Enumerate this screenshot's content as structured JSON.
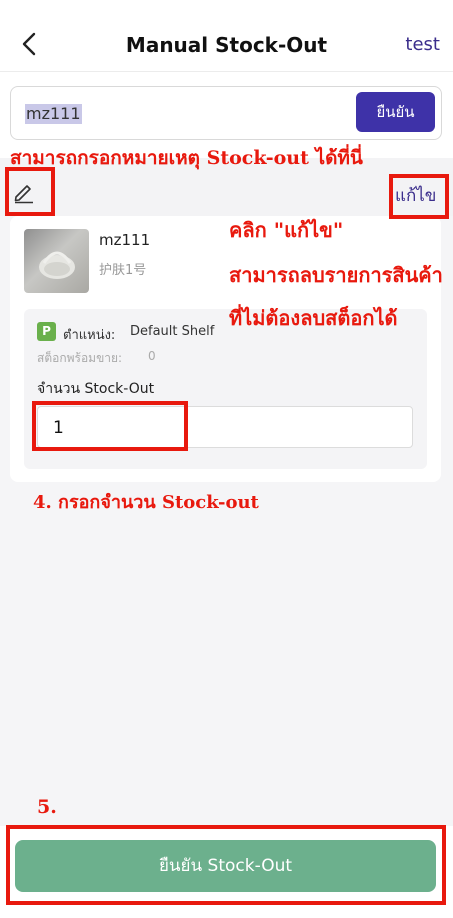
{
  "header": {
    "title": "Manual Stock-Out",
    "right_link": "test"
  },
  "search": {
    "value": "mz111",
    "confirm_label": "ยืนยัน"
  },
  "note": {
    "edit_link": "แก้ไข"
  },
  "product": {
    "name": "mz111",
    "subtitle": "护肤1号",
    "location_badge": "P",
    "location_label": "ตำแหน่ง:",
    "location_value": "Default Shelf",
    "available_label": "สต็อกพร้อมขาย:",
    "available_value": "0",
    "quantity_label": "จำนวน Stock-Out",
    "quantity_value": "1"
  },
  "footer": {
    "confirm_label": "ยืนยัน Stock-Out"
  },
  "annotations": {
    "note_hint": "สามารถกรอกหมายเหตุ Stock-out ได้ที่นี่",
    "click_edit": "คลิก \"แก้ไข\"",
    "remove_line1": "สามารถลบรายการสินค้า",
    "remove_line2": "ที่ไม่ต้องลบสต็อกได้",
    "step4": "4. กรอกจำนวน Stock-out",
    "step5": "5."
  },
  "colors": {
    "accent": "#3e32a8",
    "confirm_green": "#6cb08d",
    "annotation_red": "#e8190e",
    "badge_green": "#6ab04c"
  }
}
